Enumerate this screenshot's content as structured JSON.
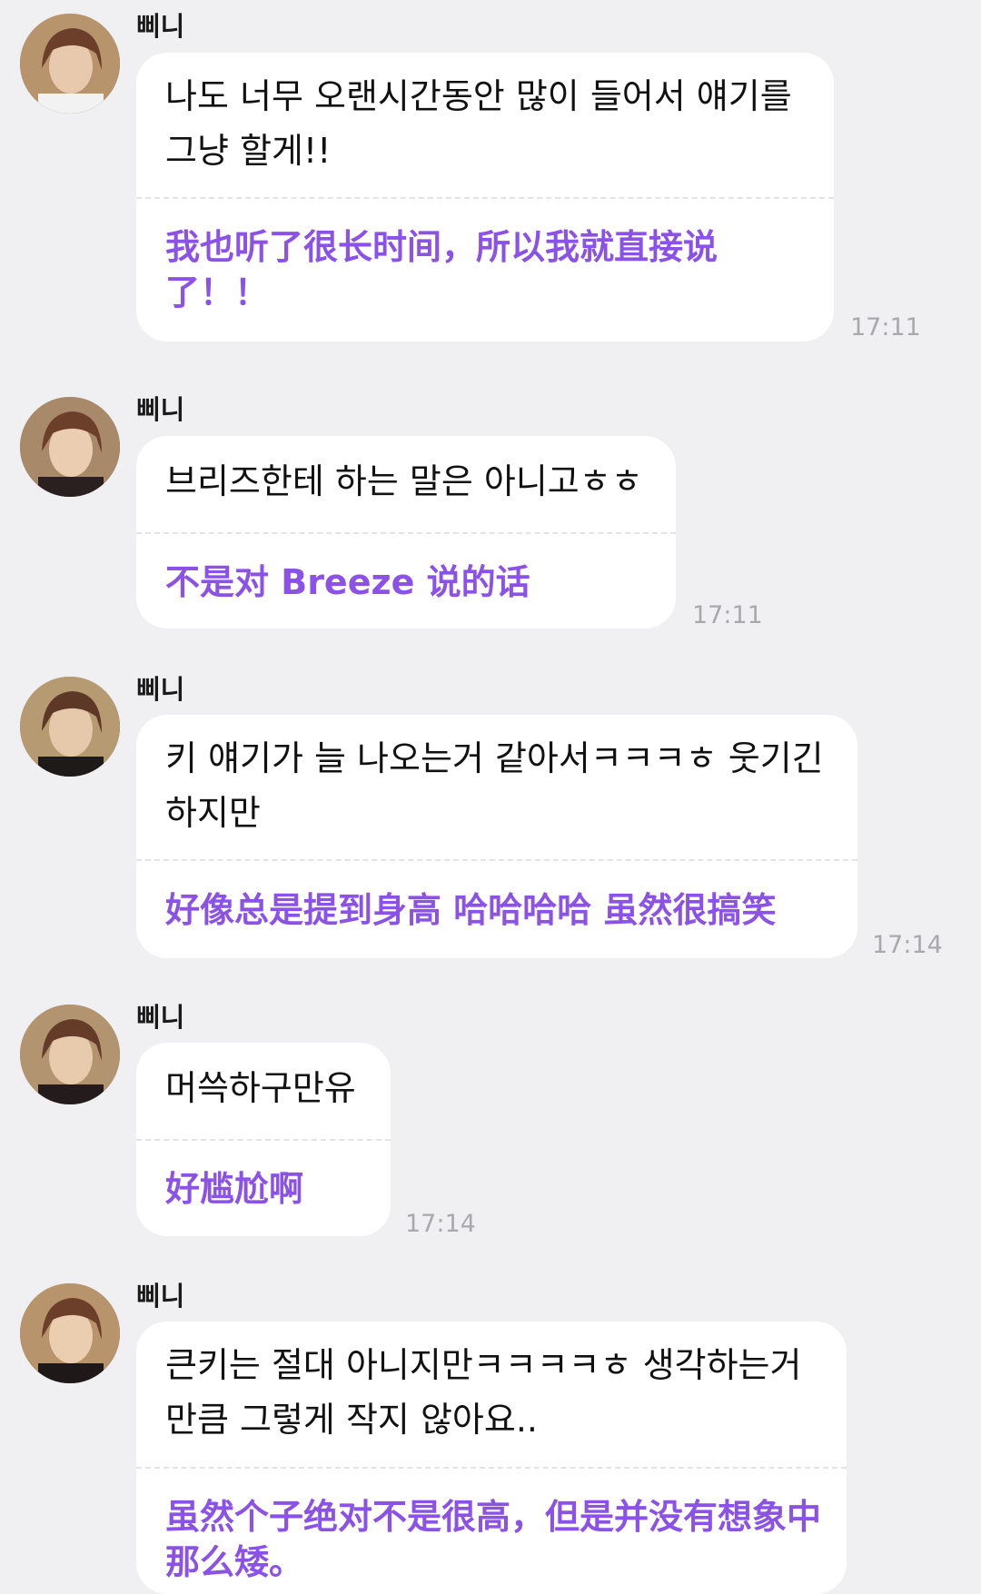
{
  "messages": [
    {
      "sender": "삐니",
      "korean": "나도 너무 오랜시간동안 많이 들어서 얘기를 그냥 할게!!",
      "translation": "我也听了很长时间，所以我就直接说了！！",
      "time": "17:11"
    },
    {
      "sender": "삐니",
      "korean": "브리즈한테 하는 말은 아니고ㅎㅎ",
      "translation": "不是对 Breeze 说的话",
      "time": "17:11"
    },
    {
      "sender": "삐니",
      "korean": "키 얘기가 늘 나오는거 같아서ㅋㅋㅋㅎ 웃기긴 하지만",
      "translation": "好像总是提到身高 哈哈哈哈 虽然很搞笑",
      "time": "17:14"
    },
    {
      "sender": "삐니",
      "korean": "머쓱하구만유",
      "translation": "好尴尬啊",
      "time": "17:14"
    },
    {
      "sender": "삐니",
      "korean": "큰키는 절대 아니지만ㅋㅋㅋㅋㅎ 생각하는거 만큼 그렇게 작지 않아요..",
      "translation": "虽然个子绝对不是很高，但是并没有想象中那么矮。",
      "time": ""
    }
  ],
  "colors": {
    "background": "#f0f0f2",
    "bubble": "#ffffff",
    "translation_text": "#8a52e6",
    "time_text": "#a9a9ad"
  },
  "icons": {
    "avatar": "profile-photo-avatar"
  }
}
